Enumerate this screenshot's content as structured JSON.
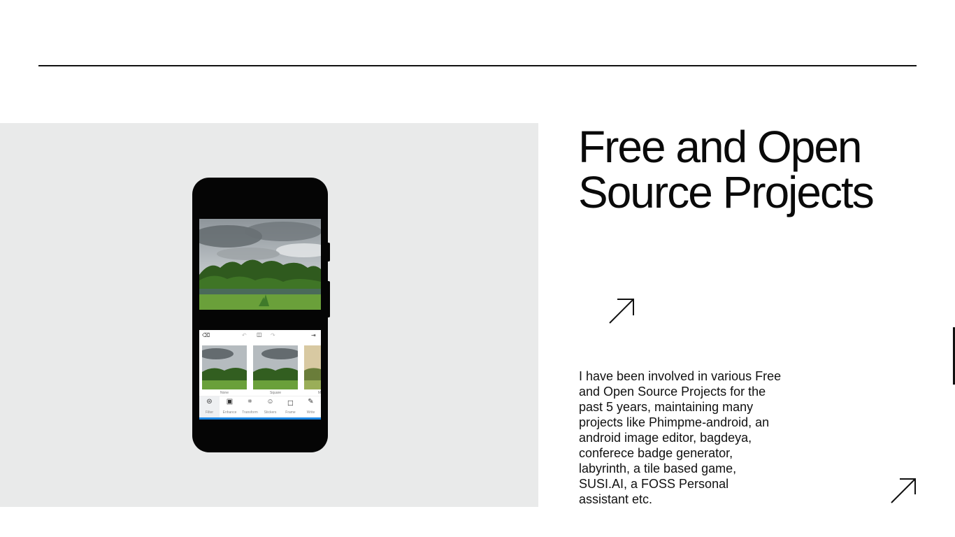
{
  "section": {
    "title": "Free and Open Source Projects",
    "description": "I have been involved in various Free and Open Source Projects for the past 5 years, maintaining many projects like Phimpme-android, an android image editor, bagdeya, conferece badge generator, labyrinth, a tile based game, SUSI.AI, a FOSS Personal assistant etc."
  },
  "editor": {
    "thumbnails": [
      {
        "label": "None"
      },
      {
        "label": "Square"
      },
      {
        "label": "M"
      }
    ],
    "tools": [
      {
        "label": "Filter",
        "icon": "filter-icon"
      },
      {
        "label": "Enhance",
        "icon": "enhance-icon"
      },
      {
        "label": "Transform",
        "icon": "transform-icon"
      },
      {
        "label": "Stickers",
        "icon": "stickers-icon"
      },
      {
        "label": "Frame",
        "icon": "frame-icon"
      },
      {
        "label": "Write",
        "icon": "write-icon"
      }
    ]
  },
  "icons": {
    "title_arrow": "arrow-up-right-icon",
    "corner_arrow": "arrow-up-right-icon"
  },
  "colors": {
    "background": "#ffffff",
    "panel": "#e9eaea",
    "text": "#111111",
    "accent": "#1e88e5"
  }
}
